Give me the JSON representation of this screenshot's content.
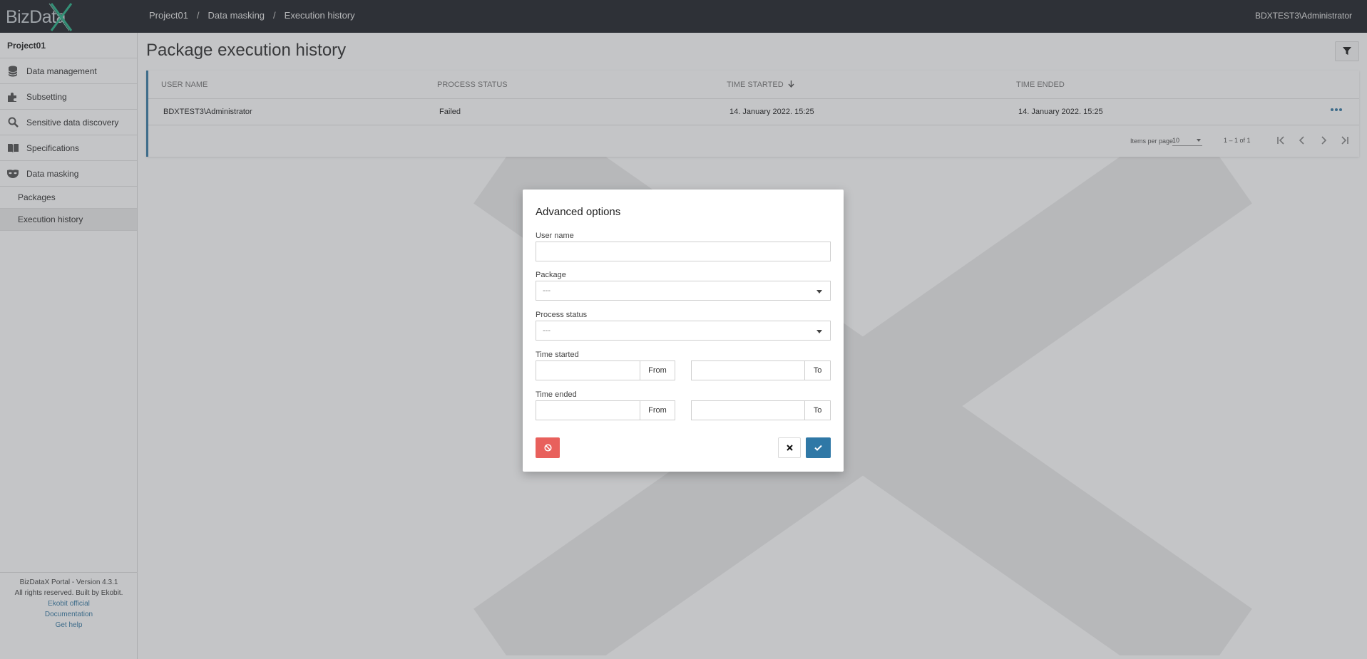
{
  "app": {
    "logo_text": "BizData",
    "logo_mark": "X"
  },
  "breadcrumb": [
    "Project01",
    "Data masking",
    "Execution history"
  ],
  "user": "BDXTEST3\\Administrator",
  "sidebar": {
    "project": "Project01",
    "items": [
      {
        "label": "Data management",
        "icon": "database-icon"
      },
      {
        "label": "Subsetting",
        "icon": "puzzle-icon"
      },
      {
        "label": "Sensitive data discovery",
        "icon": "search-icon"
      },
      {
        "label": "Specifications",
        "icon": "book-icon"
      },
      {
        "label": "Data masking",
        "icon": "mask-icon"
      }
    ],
    "sub_items": [
      {
        "label": "Packages"
      },
      {
        "label": "Execution history"
      }
    ],
    "footer": {
      "version": "BizDataX Portal - Version 4.3.1",
      "rights": "All rights reserved. Built by Ekobit.",
      "links": [
        "Ekobit official",
        "Documentation",
        "Get help"
      ]
    }
  },
  "main": {
    "title": "Package execution history",
    "table": {
      "columns": [
        "USER NAME",
        "PROCESS STATUS",
        "TIME STARTED",
        "TIME ENDED"
      ],
      "rows": [
        {
          "user": "BDXTEST3\\Administrator",
          "status": "Failed",
          "started": "14. January 2022. 15:25",
          "ended": "14. January 2022. 15:25"
        }
      ]
    },
    "paginator": {
      "label": "Items per page:",
      "page_size": "10",
      "range": "1 – 1 of 1"
    }
  },
  "modal": {
    "title": "Advanced options",
    "user_name_label": "User name",
    "user_name_value": "",
    "package_label": "Package",
    "package_value": "---",
    "status_label": "Process status",
    "status_value": "---",
    "time_started_label": "Time started",
    "time_ended_label": "Time ended",
    "from_label": "From",
    "to_label": "To"
  },
  "colors": {
    "accent": "#2f78a6",
    "danger": "#e8605c",
    "topbar": "#22262b"
  }
}
